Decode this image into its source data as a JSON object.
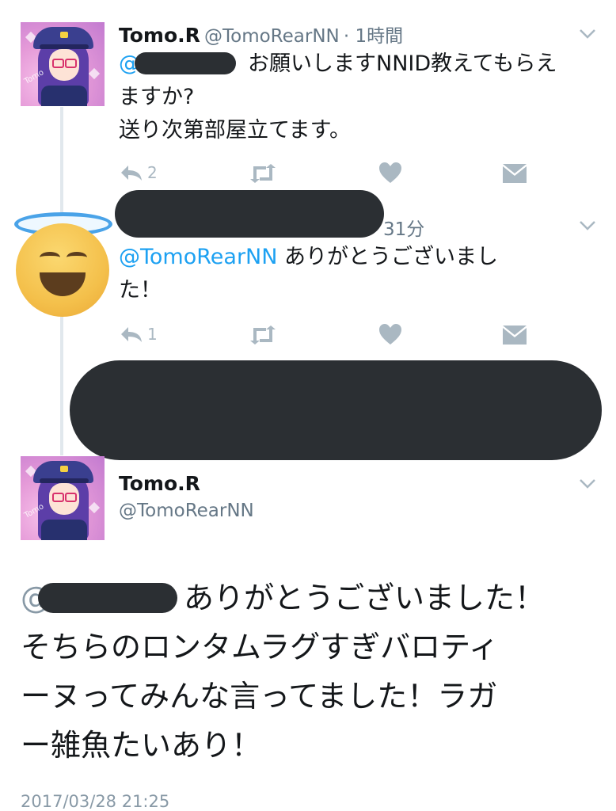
{
  "tweet1": {
    "name": "Tomo.R",
    "handle": "@TomoRearNN",
    "time": "· 1時間",
    "mention_prefix": "@",
    "text_line1": "お願いしますNNID教えてもらえ",
    "text_line2": "ますか?",
    "text_line3": "送り次第部屋立てます。",
    "reply_count": "2"
  },
  "tweet2": {
    "time": "31分",
    "mention": "@TomoRearNN",
    "text_line1": "ありがとうございまし",
    "text_line2": "た！",
    "reply_count": "1"
  },
  "tweet3": {
    "name": "Tomo.R",
    "handle": "@TomoRearNN",
    "mention_prefix": "@",
    "text_line1": "ありがとうございました！",
    "text_line2": "そちらのロンタムラグすぎバロティ",
    "text_line3": "ーヌってみんな言ってました！ラガ",
    "text_line4": "ー雑魚たいあり！",
    "timestamp": "2017/03/28 21:25"
  },
  "avatar_tag": "Tomo"
}
